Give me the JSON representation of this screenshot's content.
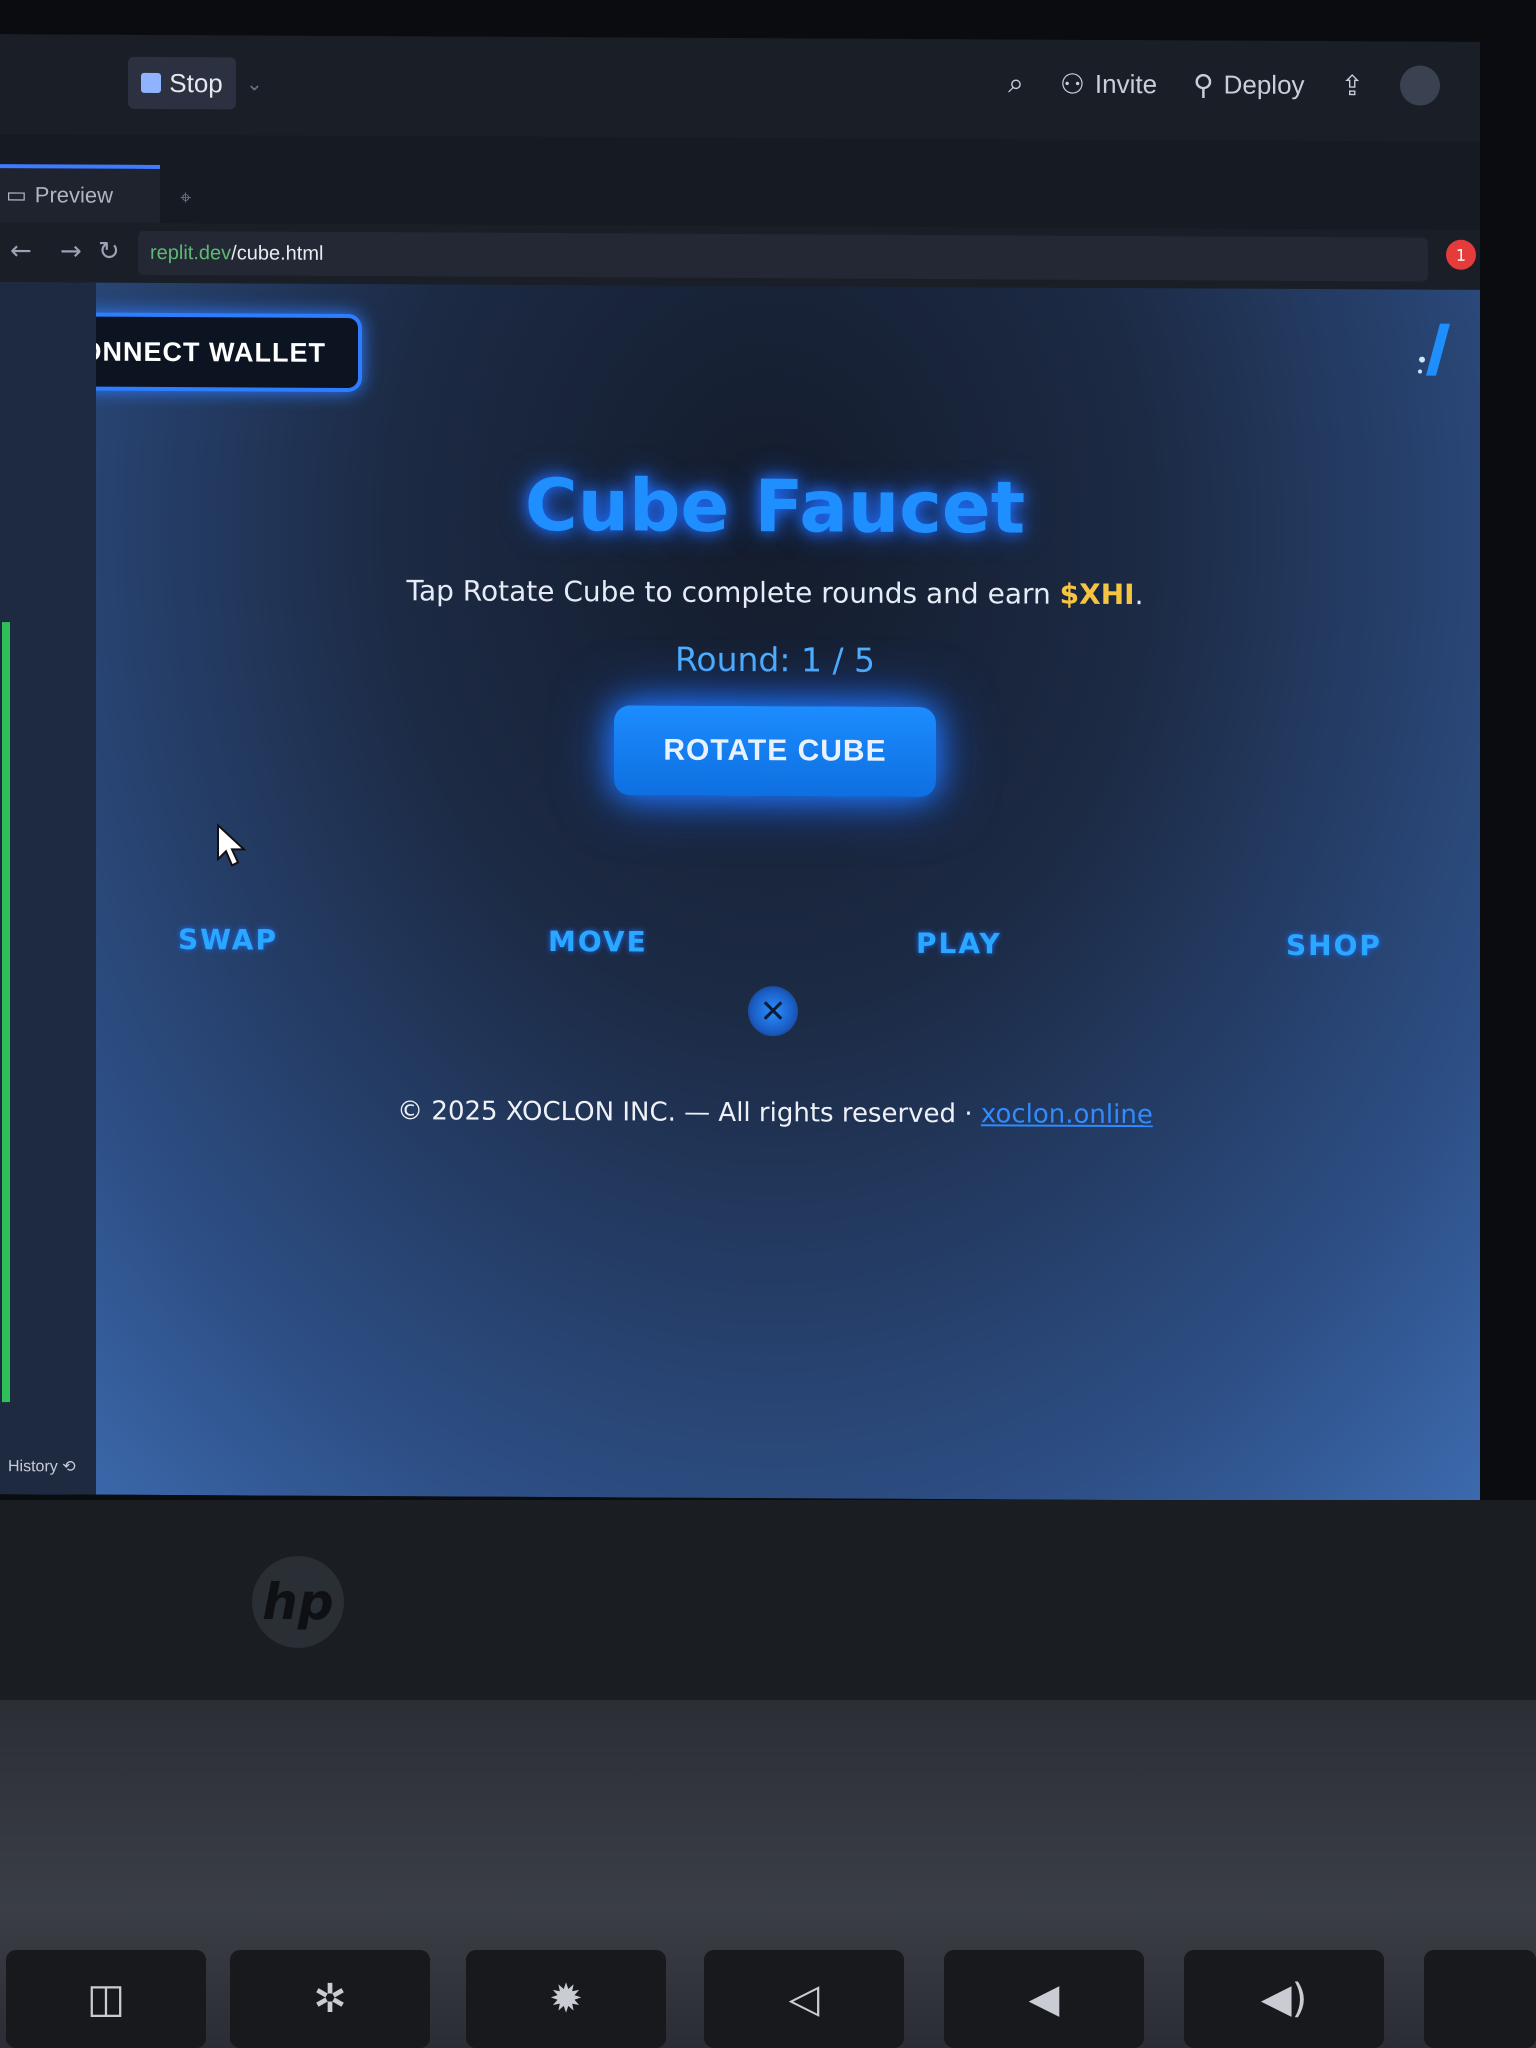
{
  "toolbar": {
    "stop_label": "Stop",
    "invite_label": "Invite",
    "deploy_label": "Deploy"
  },
  "tab": {
    "label": "Preview"
  },
  "url": {
    "domain": "replit.dev",
    "path": "/cube.html"
  },
  "notification_count": "1",
  "sidebar": {
    "history_label": "History"
  },
  "page": {
    "connect_wallet": "CONNECT WALLET",
    "title": "Cube Faucet",
    "subtitle_prefix": "Tap Rotate Cube to complete rounds and earn ",
    "token": "$XHI",
    "subtitle_suffix": ".",
    "round": "Round: 1 / 5",
    "rotate_button": "ROTATE CUBE",
    "nav": [
      "SWAP",
      "MOVE",
      "PLAY",
      "SHOP"
    ],
    "footer_text": "© 2025 XOCLON INC. — All rights reserved · ",
    "footer_link": "xoclon.online"
  },
  "device": {
    "brand": "hp"
  },
  "colors": {
    "accent": "#1f8fff",
    "token": "#f5c542",
    "notification": "#e53b3b"
  },
  "icons": [
    "stop-icon",
    "search-icon",
    "invite-icon",
    "deploy-icon",
    "account-icon",
    "preview-icon",
    "back-icon",
    "refresh-icon",
    "x-social-icon",
    "cursor-icon"
  ]
}
